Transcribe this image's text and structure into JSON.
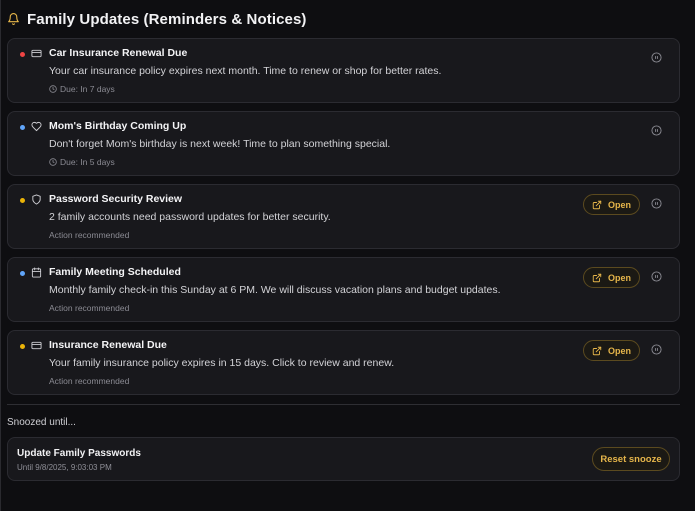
{
  "header": {
    "title": "Family Updates (Reminders & Notices)"
  },
  "colors": {
    "accent": "#e5b54a",
    "red": "#ef4444",
    "blue": "#60a5fa",
    "yellow": "#eab308"
  },
  "notices": [
    {
      "title": "Car Insurance Renewal Due",
      "message": "Your car insurance policy expires next month. Time to renew or shop for better rates.",
      "meta": "Due: In 7 days",
      "icon": "card-icon",
      "dot": "red"
    },
    {
      "title": "Mom's Birthday Coming Up",
      "message": "Don't forget Mom's birthday is next week! Time to plan something special.",
      "meta": "Due: In 5 days",
      "icon": "heart-icon",
      "dot": "blue"
    },
    {
      "title": "Password Security Review",
      "message": "2 family accounts need password updates for better security.",
      "meta": "Action recommended",
      "icon": "shield-icon",
      "dot": "yellow",
      "action": "Open"
    },
    {
      "title": "Family Meeting Scheduled",
      "message": "Monthly family check-in this Sunday at 6 PM. We will discuss vacation plans and budget updates.",
      "meta": "Action recommended",
      "icon": "calendar-icon",
      "dot": "blue",
      "action": "Open"
    },
    {
      "title": "Insurance Renewal Due",
      "message": "Your family insurance policy expires in 15 days. Click to review and renew.",
      "meta": "Action recommended",
      "icon": "card-icon",
      "dot": "yellow",
      "action": "Open"
    }
  ],
  "snoozed": {
    "label": "Snoozed until...",
    "item": {
      "title": "Update Family Passwords",
      "until": "Until 9/8/2025, 9:03:03 PM",
      "button": "Reset snooze"
    }
  }
}
